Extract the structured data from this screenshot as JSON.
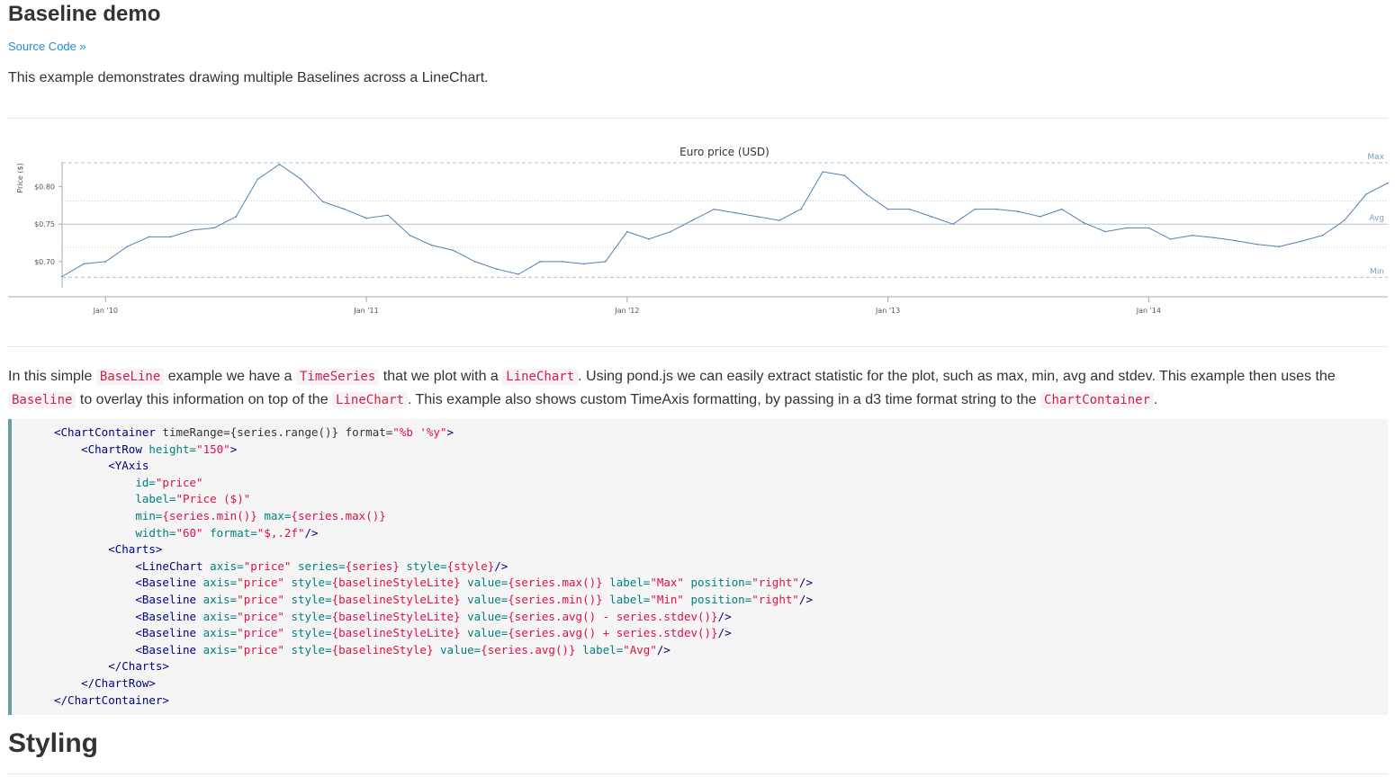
{
  "page": {
    "title": "Baseline demo",
    "source_link": "Source Code »",
    "intro": "This example demonstrates drawing multiple Baselines across a LineChart.",
    "section2_title": "Styling"
  },
  "description": {
    "p1": "In this simple ",
    "c1": "BaseLine",
    "p2": " example we have a ",
    "c2": "TimeSeries",
    "p3": " that we plot with a ",
    "c3": "LineChart",
    "p4": ". Using pond.js we can easily extract statistic for the plot, such as max, min, avg and stdev. This example then uses the ",
    "c4": "Baseline",
    "p5": " to overlay this information on top of the ",
    "c5": "LineChart",
    "p6": ". This example also shows custom TimeAxis formatting, by passing in a d3 time format string to the ",
    "c6": "ChartContainer",
    "p7": "."
  },
  "code_lines": [
    [
      [
        "t-tag",
        "<ChartContainer"
      ],
      [
        "t-plain",
        " timeRange={series.range()} format="
      ],
      [
        "t-str",
        "\"%b '%y\""
      ],
      [
        "t-tag",
        ">"
      ]
    ],
    [
      [
        "t-plain",
        "    "
      ],
      [
        "t-tag",
        "<ChartRow"
      ],
      [
        "t-plain",
        " "
      ],
      [
        "t-attr",
        "height="
      ],
      [
        "t-str",
        "\"150\""
      ],
      [
        "t-tag",
        ">"
      ]
    ],
    [
      [
        "t-plain",
        "        "
      ],
      [
        "t-tag",
        "<YAxis"
      ]
    ],
    [
      [
        "t-plain",
        "            "
      ],
      [
        "t-attr",
        "id="
      ],
      [
        "t-str",
        "\"price\""
      ]
    ],
    [
      [
        "t-plain",
        "            "
      ],
      [
        "t-attr",
        "label="
      ],
      [
        "t-str",
        "\"Price ($)\""
      ]
    ],
    [
      [
        "t-plain",
        "            "
      ],
      [
        "t-attr",
        "min="
      ],
      [
        "t-str",
        "{series.min()}"
      ],
      [
        "t-plain",
        " "
      ],
      [
        "t-attr",
        "max="
      ],
      [
        "t-str",
        "{series.max()}"
      ]
    ],
    [
      [
        "t-plain",
        "            "
      ],
      [
        "t-attr",
        "width="
      ],
      [
        "t-str",
        "\"60\""
      ],
      [
        "t-plain",
        " "
      ],
      [
        "t-attr",
        "format="
      ],
      [
        "t-str",
        "\"$,.2f\""
      ],
      [
        "t-tag",
        "/>"
      ]
    ],
    [
      [
        "t-plain",
        "        "
      ],
      [
        "t-tag",
        "<Charts>"
      ]
    ],
    [
      [
        "t-plain",
        "            "
      ],
      [
        "t-tag",
        "<LineChart"
      ],
      [
        "t-plain",
        " "
      ],
      [
        "t-attr",
        "axis="
      ],
      [
        "t-str",
        "\"price\""
      ],
      [
        "t-plain",
        " "
      ],
      [
        "t-attr",
        "series="
      ],
      [
        "t-str",
        "{series}"
      ],
      [
        "t-plain",
        " "
      ],
      [
        "t-attr",
        "style="
      ],
      [
        "t-str",
        "{style}"
      ],
      [
        "t-tag",
        "/>"
      ]
    ],
    [
      [
        "t-plain",
        "            "
      ],
      [
        "t-tag",
        "<Baseline"
      ],
      [
        "t-plain",
        " "
      ],
      [
        "t-attr",
        "axis="
      ],
      [
        "t-str",
        "\"price\""
      ],
      [
        "t-plain",
        " "
      ],
      [
        "t-attr",
        "style="
      ],
      [
        "t-str",
        "{baselineStyleLite}"
      ],
      [
        "t-plain",
        " "
      ],
      [
        "t-attr",
        "value="
      ],
      [
        "t-str",
        "{series.max()}"
      ],
      [
        "t-plain",
        " "
      ],
      [
        "t-attr",
        "label="
      ],
      [
        "t-str",
        "\"Max\""
      ],
      [
        "t-plain",
        " "
      ],
      [
        "t-attr",
        "position="
      ],
      [
        "t-str",
        "\"right\""
      ],
      [
        "t-tag",
        "/>"
      ]
    ],
    [
      [
        "t-plain",
        "            "
      ],
      [
        "t-tag",
        "<Baseline"
      ],
      [
        "t-plain",
        " "
      ],
      [
        "t-attr",
        "axis="
      ],
      [
        "t-str",
        "\"price\""
      ],
      [
        "t-plain",
        " "
      ],
      [
        "t-attr",
        "style="
      ],
      [
        "t-str",
        "{baselineStyleLite}"
      ],
      [
        "t-plain",
        " "
      ],
      [
        "t-attr",
        "value="
      ],
      [
        "t-str",
        "{series.min()}"
      ],
      [
        "t-plain",
        " "
      ],
      [
        "t-attr",
        "label="
      ],
      [
        "t-str",
        "\"Min\""
      ],
      [
        "t-plain",
        " "
      ],
      [
        "t-attr",
        "position="
      ],
      [
        "t-str",
        "\"right\""
      ],
      [
        "t-tag",
        "/>"
      ]
    ],
    [
      [
        "t-plain",
        "            "
      ],
      [
        "t-tag",
        "<Baseline"
      ],
      [
        "t-plain",
        " "
      ],
      [
        "t-attr",
        "axis="
      ],
      [
        "t-str",
        "\"price\""
      ],
      [
        "t-plain",
        " "
      ],
      [
        "t-attr",
        "style="
      ],
      [
        "t-str",
        "{baselineStyleLite}"
      ],
      [
        "t-plain",
        " "
      ],
      [
        "t-attr",
        "value="
      ],
      [
        "t-str",
        "{series.avg() - series.stdev()}"
      ],
      [
        "t-tag",
        "/>"
      ]
    ],
    [
      [
        "t-plain",
        "            "
      ],
      [
        "t-tag",
        "<Baseline"
      ],
      [
        "t-plain",
        " "
      ],
      [
        "t-attr",
        "axis="
      ],
      [
        "t-str",
        "\"price\""
      ],
      [
        "t-plain",
        " "
      ],
      [
        "t-attr",
        "style="
      ],
      [
        "t-str",
        "{baselineStyleLite}"
      ],
      [
        "t-plain",
        " "
      ],
      [
        "t-attr",
        "value="
      ],
      [
        "t-str",
        "{series.avg() + series.stdev()}"
      ],
      [
        "t-tag",
        "/>"
      ]
    ],
    [
      [
        "t-plain",
        "            "
      ],
      [
        "t-tag",
        "<Baseline"
      ],
      [
        "t-plain",
        " "
      ],
      [
        "t-attr",
        "axis="
      ],
      [
        "t-str",
        "\"price\""
      ],
      [
        "t-plain",
        " "
      ],
      [
        "t-attr",
        "style="
      ],
      [
        "t-str",
        "{baselineStyle}"
      ],
      [
        "t-plain",
        " "
      ],
      [
        "t-attr",
        "value="
      ],
      [
        "t-str",
        "{series.avg()}"
      ],
      [
        "t-plain",
        " "
      ],
      [
        "t-attr",
        "label="
      ],
      [
        "t-str",
        "\"Avg\""
      ],
      [
        "t-tag",
        "/>"
      ]
    ],
    [
      [
        "t-plain",
        "        "
      ],
      [
        "t-tag",
        "</Charts>"
      ]
    ],
    [
      [
        "t-plain",
        "    "
      ],
      [
        "t-tag",
        "</ChartRow>"
      ]
    ],
    [
      [
        "t-tag",
        "</ChartContainer>"
      ]
    ]
  ],
  "colors": {
    "line": "#4f80b3",
    "baseline": "#a9c4d8",
    "link": "#1f8dd6",
    "code_accent": "#6a9fa4"
  },
  "chart_data": {
    "type": "line",
    "title": "Euro price (USD)",
    "ylabel": "Price ($)",
    "ylim": [
      0.665,
      0.838
    ],
    "ytick_values": [
      0.7,
      0.75,
      0.8
    ],
    "ytick_labels": [
      "$0.70",
      "$0.75",
      "$0.80"
    ],
    "xlim": [
      "2009-11",
      "2014-12"
    ],
    "xtick_dates": [
      "2010-01",
      "2011-01",
      "2012-01",
      "2013-01",
      "2014-01"
    ],
    "xtick_labels": [
      "Jan '10",
      "Jan '11",
      "Jan '12",
      "Jan '13",
      "Jan '14"
    ],
    "baselines": [
      {
        "label": "Max",
        "value": 0.832,
        "style": "dashed"
      },
      {
        "label": "Min",
        "value": 0.679,
        "style": "dashed"
      },
      {
        "label": "Avg",
        "value": 0.75,
        "style": "solid"
      },
      {
        "label": "",
        "value": 0.781,
        "style": "dotted"
      },
      {
        "label": "",
        "value": 0.719,
        "style": "dotted"
      }
    ],
    "series": [
      {
        "x": [
          "2009-11",
          "2009-12",
          "2010-01",
          "2010-02",
          "2010-03",
          "2010-04",
          "2010-05",
          "2010-06",
          "2010-07",
          "2010-08",
          "2010-09",
          "2010-10",
          "2010-11",
          "2010-12",
          "2011-01",
          "2011-02",
          "2011-03",
          "2011-04",
          "2011-05",
          "2011-06",
          "2011-07",
          "2011-08",
          "2011-09",
          "2011-10",
          "2011-11",
          "2011-12",
          "2012-01",
          "2012-02",
          "2012-03",
          "2012-04",
          "2012-05",
          "2012-06",
          "2012-07",
          "2012-08",
          "2012-09",
          "2012-10",
          "2012-11",
          "2012-12",
          "2013-01",
          "2013-02",
          "2013-03",
          "2013-04",
          "2013-05",
          "2013-06",
          "2013-07",
          "2013-08",
          "2013-09",
          "2013-10",
          "2013-11",
          "2013-12",
          "2014-01",
          "2014-02",
          "2014-03",
          "2014-04",
          "2014-05",
          "2014-06",
          "2014-07",
          "2014-08",
          "2014-09",
          "2014-10",
          "2014-11",
          "2014-12"
        ],
        "values": [
          0.68,
          0.697,
          0.7,
          0.72,
          0.733,
          0.733,
          0.742,
          0.745,
          0.76,
          0.81,
          0.83,
          0.81,
          0.78,
          0.77,
          0.758,
          0.762,
          0.735,
          0.722,
          0.715,
          0.7,
          0.69,
          0.683,
          0.7,
          0.7,
          0.697,
          0.7,
          0.74,
          0.73,
          0.74,
          0.755,
          0.77,
          0.765,
          0.76,
          0.755,
          0.77,
          0.82,
          0.815,
          0.79,
          0.77,
          0.77,
          0.76,
          0.75,
          0.77,
          0.77,
          0.767,
          0.76,
          0.77,
          0.752,
          0.74,
          0.745,
          0.745,
          0.73,
          0.735,
          0.732,
          0.728,
          0.723,
          0.72,
          0.727,
          0.735,
          0.755,
          0.79,
          0.805
        ]
      }
    ]
  }
}
